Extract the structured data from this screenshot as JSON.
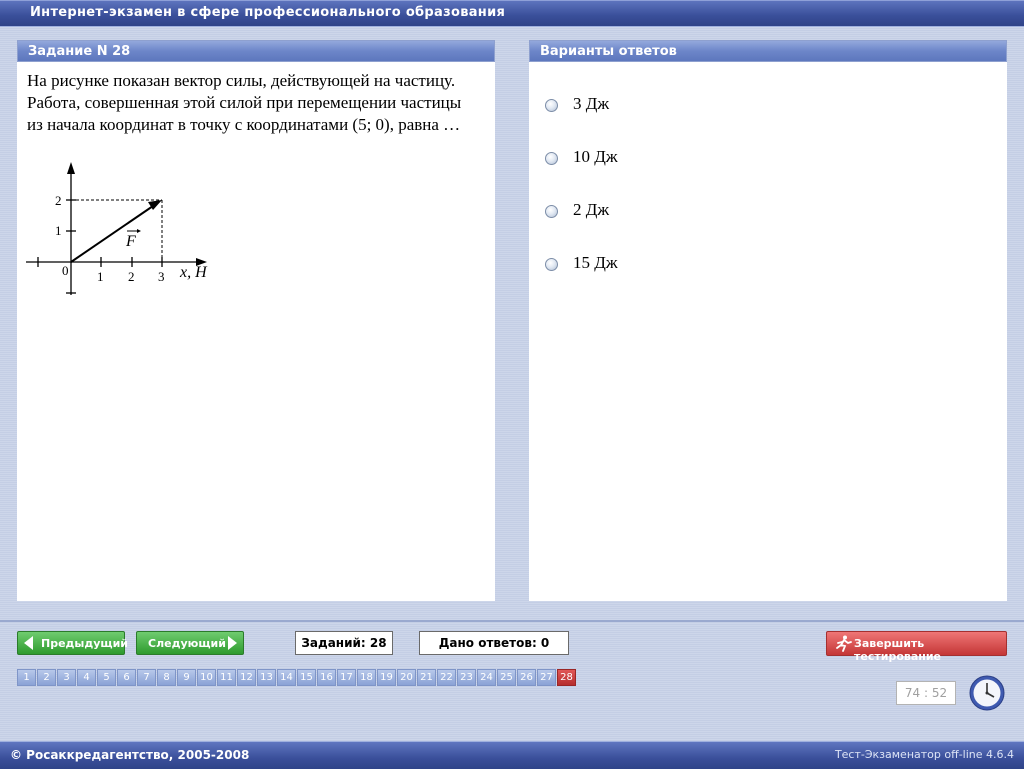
{
  "app": {
    "title": "Интернет-экзамен в сфере профессионального образования"
  },
  "task": {
    "header": "Задание N 28",
    "question": "На рисунке показан вектор силы, действующей на частицу. Работа, совершенная этой силой при перемещении частицы из начала координат в точку с координатами (5; 0), равна …",
    "figure": {
      "axis_label": "x, Н",
      "vector_label": "F",
      "x_ticks": [
        "0",
        "1",
        "2",
        "3"
      ],
      "y_ticks": [
        "1",
        "2"
      ],
      "vector": {
        "x": 3,
        "y": 2
      }
    }
  },
  "answers": {
    "header": "Варианты ответов",
    "options": [
      {
        "label": "3 Дж"
      },
      {
        "label": "10 Дж"
      },
      {
        "label": "2 Дж"
      },
      {
        "label": "15 Дж"
      }
    ]
  },
  "navigation": {
    "prev_label": "Предыдущий",
    "next_label": "Следующий",
    "tasks_count": "Заданий: 28",
    "answers_count": "Дано ответов: 0",
    "finish_label": "Завершить тестирование",
    "question_numbers": [
      "1",
      "2",
      "3",
      "4",
      "5",
      "6",
      "7",
      "8",
      "9",
      "10",
      "11",
      "12",
      "13",
      "14",
      "15",
      "16",
      "17",
      "18",
      "19",
      "20",
      "21",
      "22",
      "23",
      "24",
      "25",
      "26",
      "27",
      "28"
    ],
    "current_question": "28"
  },
  "timer": {
    "value": "74 : 52"
  },
  "footer": {
    "copyright": "© Росаккредагентство, 2005-2008",
    "version": "Тест-Экзаменатор off-line 4.6.4"
  },
  "colors": {
    "header_blue": "#3a4f9a",
    "green_button": "#2e9b2e",
    "red_button": "#c43636",
    "active_question": "#b62e2e"
  },
  "icons": {
    "prev": "arrow-left-icon",
    "next": "arrow-right-icon",
    "finish": "running-man-icon",
    "timer": "clock-icon"
  }
}
